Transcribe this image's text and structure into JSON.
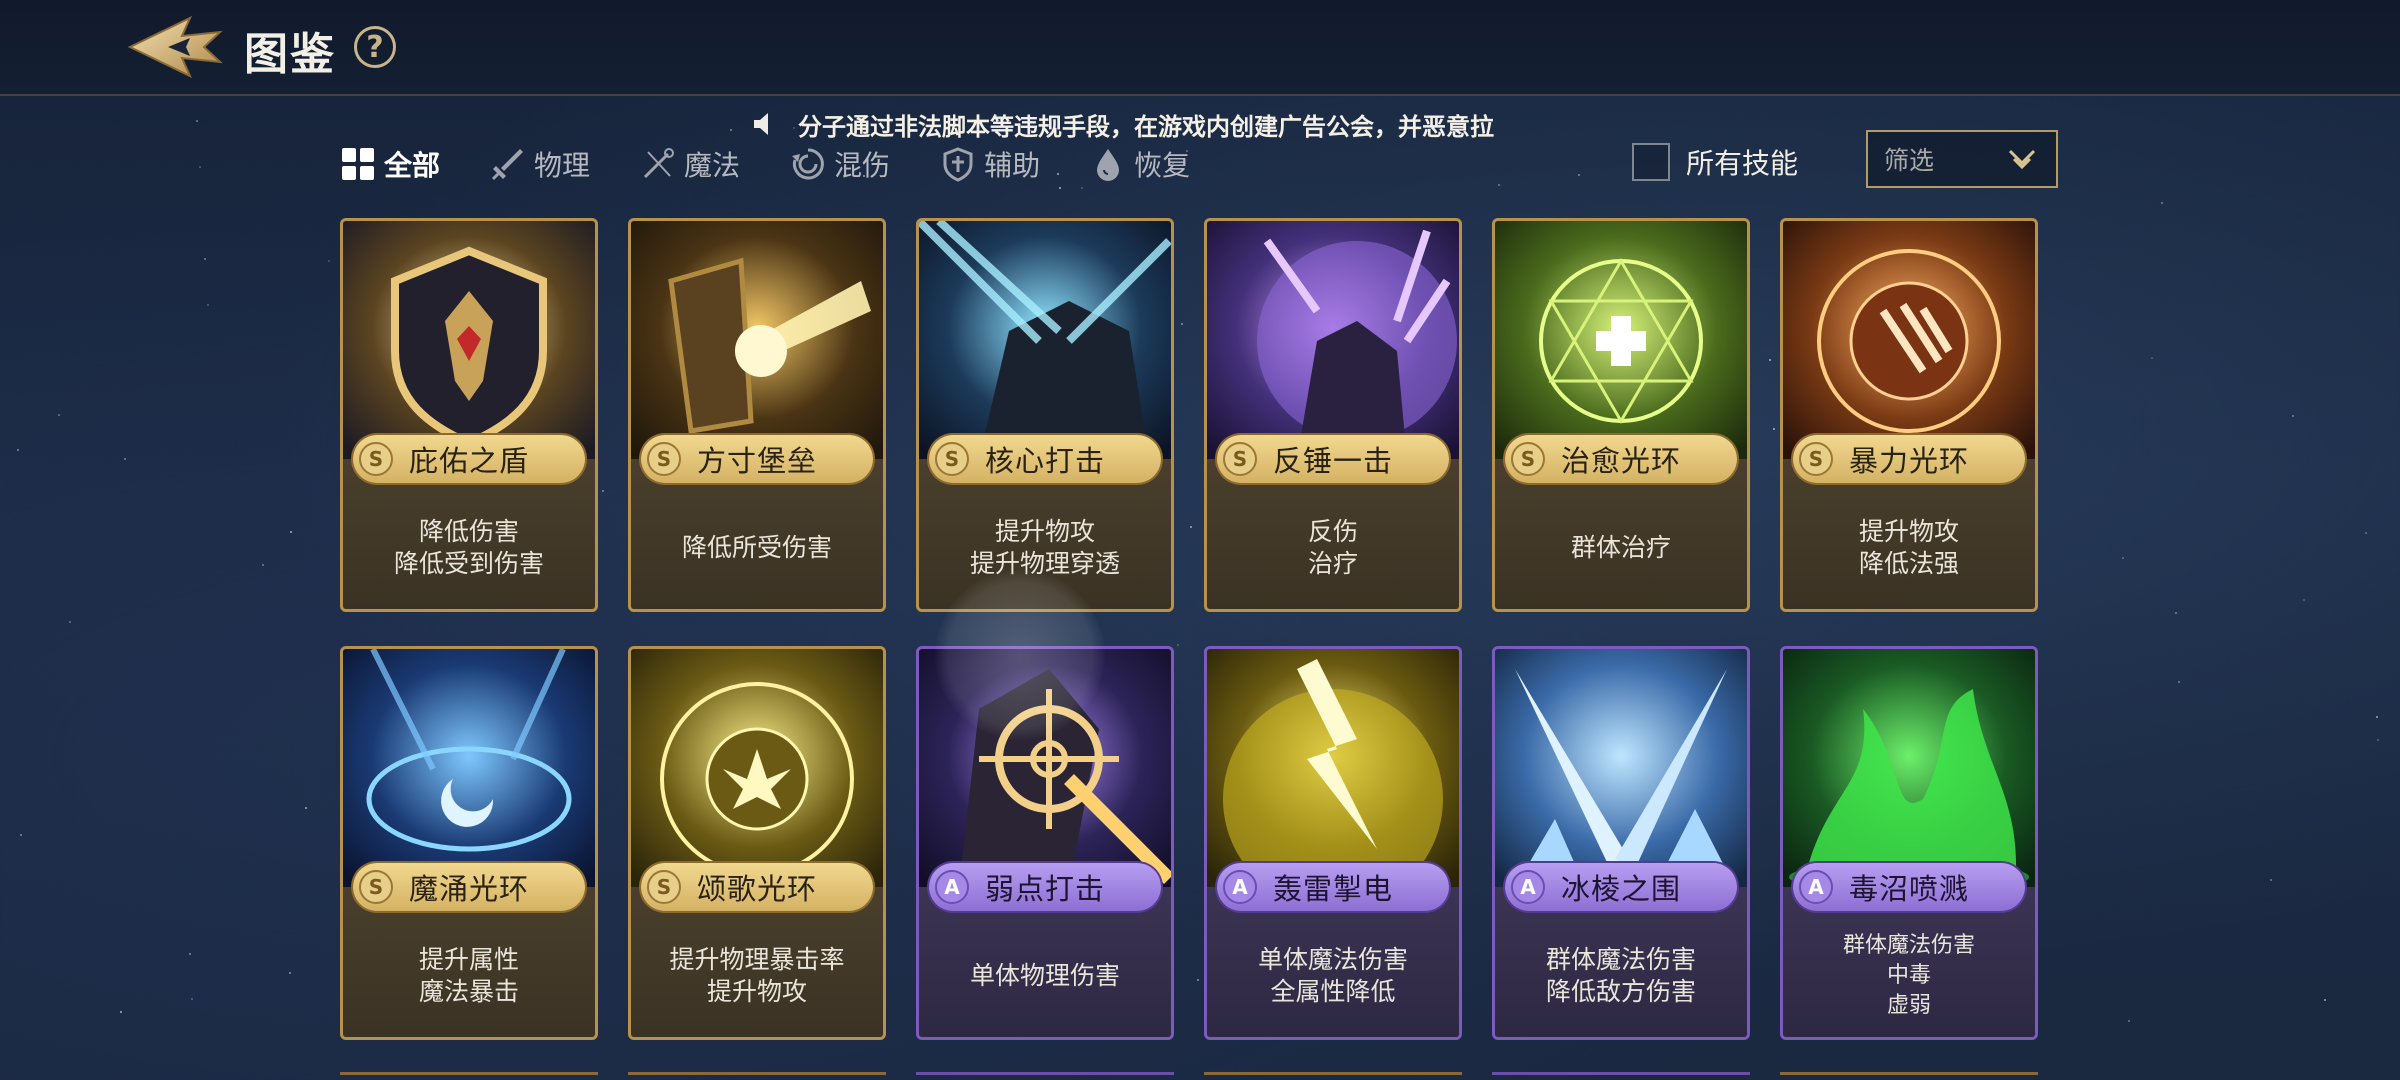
{
  "header": {
    "title": "图鉴",
    "help_label": "?"
  },
  "announcement": {
    "text": "分子通过非法脚本等违规手段，在游戏内创建广告公会，并恶意拉"
  },
  "tabs": [
    {
      "label": "全部",
      "icon": "grid-icon",
      "active": true
    },
    {
      "label": "物理",
      "icon": "sword-icon",
      "active": false
    },
    {
      "label": "魔法",
      "icon": "staff-icon",
      "active": false
    },
    {
      "label": "混伤",
      "icon": "swirl-icon",
      "active": false
    },
    {
      "label": "辅助",
      "icon": "shield-icon",
      "active": false
    },
    {
      "label": "恢复",
      "icon": "droplet-icon",
      "active": false
    }
  ],
  "skills_toggle": {
    "label": "所有技能",
    "checked": false
  },
  "filter": {
    "placeholder": "筛选"
  },
  "colors": {
    "rank_S": "#d4b264",
    "rank_A": "#8d6fd4",
    "border_S": "#b9924a",
    "border_A": "#7c5ac0"
  },
  "cards": [
    {
      "rank": "S",
      "name": "庇佑之盾",
      "desc": [
        "降低伤害",
        "降低受到伤害"
      ],
      "art": "shield"
    },
    {
      "rank": "S",
      "name": "方寸堡垒",
      "desc": [
        "降低所受伤害"
      ],
      "art": "fortress"
    },
    {
      "rank": "S",
      "name": "核心打击",
      "desc": [
        "提升物攻",
        "提升物理穿透"
      ],
      "art": "strike"
    },
    {
      "rank": "S",
      "name": "反锤一击",
      "desc": [
        "反伤",
        "治疗"
      ],
      "art": "counter"
    },
    {
      "rank": "S",
      "name": "治愈光环",
      "desc": [
        "群体治疗"
      ],
      "art": "heal"
    },
    {
      "rank": "S",
      "name": "暴力光环",
      "desc": [
        "提升物攻",
        "降低法强"
      ],
      "art": "violence"
    },
    {
      "rank": "S",
      "name": "魔涌光环",
      "desc": [
        "提升属性",
        "魔法暴击"
      ],
      "art": "moon"
    },
    {
      "rank": "S",
      "name": "颂歌光环",
      "desc": [
        "提升物理暴击率",
        "提升物攻"
      ],
      "art": "hymn"
    },
    {
      "rank": "A",
      "name": "弱点打击",
      "desc": [
        "单体物理伤害"
      ],
      "art": "target"
    },
    {
      "rank": "A",
      "name": "轰雷掣电",
      "desc": [
        "单体魔法伤害",
        "全属性降低"
      ],
      "art": "thunder"
    },
    {
      "rank": "A",
      "name": "冰棱之围",
      "desc": [
        "群体魔法伤害",
        "降低敌方伤害"
      ],
      "art": "ice"
    },
    {
      "rank": "A",
      "name": "毒沼喷溅",
      "desc": [
        "群体魔法伤害",
        "中毒",
        "虚弱"
      ],
      "art": "poison"
    }
  ]
}
